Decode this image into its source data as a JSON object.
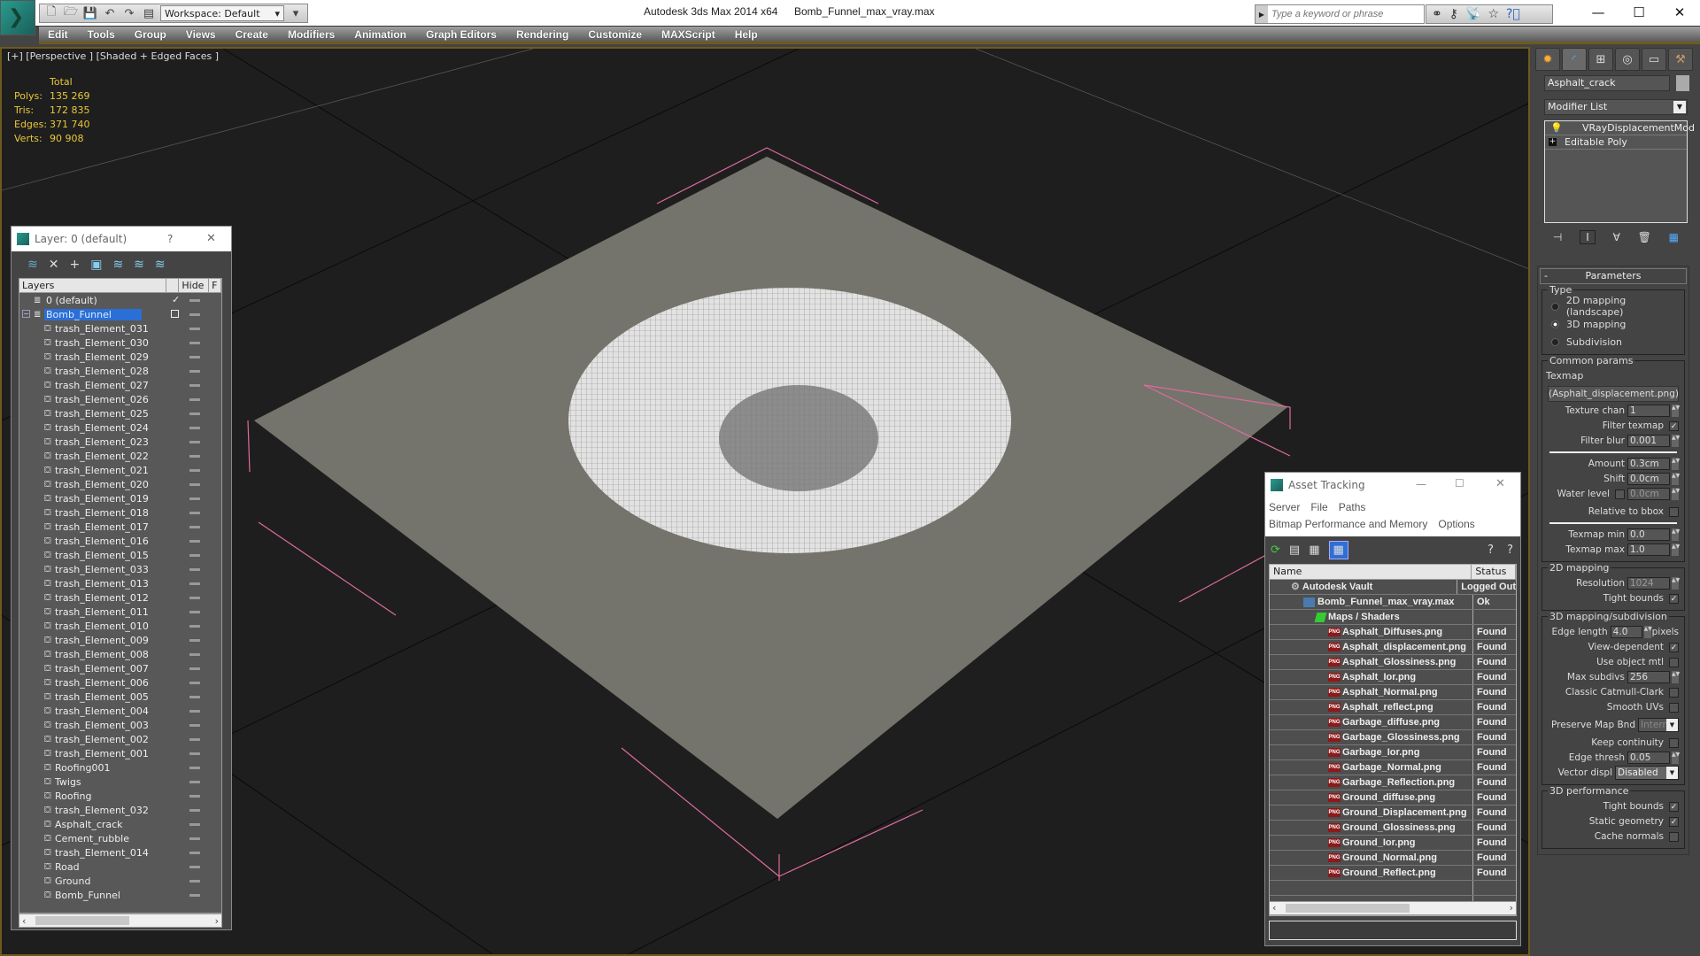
{
  "titlebar": {
    "app_title": "Autodesk 3ds Max  2014 x64",
    "file_name": "Bomb_Funnel_max_vray.max",
    "workspace": "Workspace: Default",
    "search_placeholder": "Type a keyword or phrase",
    "window_controls": {
      "minimize": "—",
      "maximize": "☐",
      "close": "✕"
    }
  },
  "menubar": {
    "items": [
      "Edit",
      "Tools",
      "Group",
      "Views",
      "Create",
      "Modifiers",
      "Animation",
      "Graph Editors",
      "Rendering",
      "Customize",
      "MAXScript",
      "Help"
    ]
  },
  "viewport": {
    "label": "[+] [Perspective ] [Shaded + Edged Faces ]",
    "stats": {
      "header": "Total",
      "rows": [
        {
          "label": "Polys:",
          "value": "135 269"
        },
        {
          "label": "Tris:",
          "value": "172 835"
        },
        {
          "label": "Edges:",
          "value": "371 740"
        },
        {
          "label": "Verts:",
          "value": "90 908"
        }
      ]
    }
  },
  "layer_window": {
    "title": "Layer: 0 (default)",
    "help": "?",
    "close": "✕",
    "columns": [
      "Layers",
      "",
      "Hide",
      "F"
    ],
    "layers": [
      {
        "name": "0 (default)",
        "type": "layer",
        "indent": 1,
        "current": true
      },
      {
        "name": "Bomb_Funnel",
        "type": "layer",
        "indent": 0,
        "selected": true,
        "expanded": true
      },
      {
        "name": "trash_Element_031",
        "type": "object"
      },
      {
        "name": "trash_Element_030",
        "type": "object"
      },
      {
        "name": "trash_Element_029",
        "type": "object"
      },
      {
        "name": "trash_Element_028",
        "type": "object"
      },
      {
        "name": "trash_Element_027",
        "type": "object"
      },
      {
        "name": "trash_Element_026",
        "type": "object"
      },
      {
        "name": "trash_Element_025",
        "type": "object"
      },
      {
        "name": "trash_Element_024",
        "type": "object"
      },
      {
        "name": "trash_Element_023",
        "type": "object"
      },
      {
        "name": "trash_Element_022",
        "type": "object"
      },
      {
        "name": "trash_Element_021",
        "type": "object"
      },
      {
        "name": "trash_Element_020",
        "type": "object"
      },
      {
        "name": "trash_Element_019",
        "type": "object"
      },
      {
        "name": "trash_Element_018",
        "type": "object"
      },
      {
        "name": "trash_Element_017",
        "type": "object"
      },
      {
        "name": "trash_Element_016",
        "type": "object"
      },
      {
        "name": "trash_Element_015",
        "type": "object"
      },
      {
        "name": "trash_Element_033",
        "type": "object"
      },
      {
        "name": "trash_Element_013",
        "type": "object"
      },
      {
        "name": "trash_Element_012",
        "type": "object"
      },
      {
        "name": "trash_Element_011",
        "type": "object"
      },
      {
        "name": "trash_Element_010",
        "type": "object"
      },
      {
        "name": "trash_Element_009",
        "type": "object"
      },
      {
        "name": "trash_Element_008",
        "type": "object"
      },
      {
        "name": "trash_Element_007",
        "type": "object"
      },
      {
        "name": "trash_Element_006",
        "type": "object"
      },
      {
        "name": "trash_Element_005",
        "type": "object"
      },
      {
        "name": "trash_Element_004",
        "type": "object"
      },
      {
        "name": "trash_Element_003",
        "type": "object"
      },
      {
        "name": "trash_Element_002",
        "type": "object"
      },
      {
        "name": "trash_Element_001",
        "type": "object"
      },
      {
        "name": "Roofing001",
        "type": "object"
      },
      {
        "name": "Twigs",
        "type": "object"
      },
      {
        "name": "Roofing",
        "type": "object"
      },
      {
        "name": "trash_Element_032",
        "type": "object"
      },
      {
        "name": "Asphalt_crack",
        "type": "object"
      },
      {
        "name": "Cement_rubble",
        "type": "object"
      },
      {
        "name": "trash_Element_014",
        "type": "object"
      },
      {
        "name": "Road",
        "type": "object"
      },
      {
        "name": "Ground",
        "type": "object"
      },
      {
        "name": "Bomb_Funnel",
        "type": "object"
      }
    ]
  },
  "asset_tracking": {
    "title": "Asset Tracking",
    "menus_row1": [
      "Server",
      "File",
      "Paths"
    ],
    "menus_row2": [
      "Bitmap Performance and Memory",
      "Options"
    ],
    "columns": [
      "Name",
      "Status"
    ],
    "rows": [
      {
        "name": "Autodesk Vault",
        "status": "Logged Out",
        "level": 0,
        "icon": "vault"
      },
      {
        "name": "Bomb_Funnel_max_vray.max",
        "status": "Ok",
        "level": 1,
        "icon": "max"
      },
      {
        "name": "Maps / Shaders",
        "status": "",
        "level": 2,
        "icon": "maps"
      },
      {
        "name": "Asphalt_Diffuses.png",
        "status": "Found",
        "level": 3,
        "icon": "png"
      },
      {
        "name": "Asphalt_displacement.png",
        "status": "Found",
        "level": 3,
        "icon": "png"
      },
      {
        "name": "Asphalt_Glossiness.png",
        "status": "Found",
        "level": 3,
        "icon": "png"
      },
      {
        "name": "Asphalt_Ior.png",
        "status": "Found",
        "level": 3,
        "icon": "png"
      },
      {
        "name": "Asphalt_Normal.png",
        "status": "Found",
        "level": 3,
        "icon": "png"
      },
      {
        "name": "Asphalt_reflect.png",
        "status": "Found",
        "level": 3,
        "icon": "png"
      },
      {
        "name": "Garbage_diffuse.png",
        "status": "Found",
        "level": 3,
        "icon": "png"
      },
      {
        "name": "Garbage_Glossiness.png",
        "status": "Found",
        "level": 3,
        "icon": "png"
      },
      {
        "name": "Garbage_Ior.png",
        "status": "Found",
        "level": 3,
        "icon": "png"
      },
      {
        "name": "Garbage_Normal.png",
        "status": "Found",
        "level": 3,
        "icon": "png"
      },
      {
        "name": "Garbage_Reflection.png",
        "status": "Found",
        "level": 3,
        "icon": "png"
      },
      {
        "name": "Ground_diffuse.png",
        "status": "Found",
        "level": 3,
        "icon": "png"
      },
      {
        "name": "Ground_Displacement.png",
        "status": "Found",
        "level": 3,
        "icon": "png"
      },
      {
        "name": "Ground_Glossiness.png",
        "status": "Found",
        "level": 3,
        "icon": "png"
      },
      {
        "name": "Ground_Ior.png",
        "status": "Found",
        "level": 3,
        "icon": "png"
      },
      {
        "name": "Ground_Normal.png",
        "status": "Found",
        "level": 3,
        "icon": "png"
      },
      {
        "name": "Ground_Reflect.png",
        "status": "Found",
        "level": 3,
        "icon": "png"
      }
    ]
  },
  "command_panel": {
    "object_name": "Asphalt_crack",
    "modifier_list": "Modifier List",
    "stack": [
      "VRayDisplacementMod",
      "Editable Poly"
    ],
    "parameters": {
      "rollout": "Parameters",
      "type_group": "Type",
      "type_options": [
        {
          "label": "2D mapping (landscape)",
          "selected": false
        },
        {
          "label": "3D mapping",
          "selected": true
        },
        {
          "label": "Subdivision",
          "selected": false
        }
      ],
      "common_group": "Common params",
      "texmap_label": "Texmap",
      "texmap_value": "(Asphalt_displacement.png)",
      "texture_chan": {
        "label": "Texture chan",
        "value": "1"
      },
      "filter_texmap": {
        "label": "Filter texmap",
        "checked": true
      },
      "filter_blur": {
        "label": "Filter blur",
        "value": "0.001"
      },
      "amount": {
        "label": "Amount",
        "value": "0.3cm"
      },
      "shift": {
        "label": "Shift",
        "value": "0.0cm"
      },
      "water_level": {
        "label": "Water level",
        "value": "0.0cm",
        "checked": false
      },
      "relative_bbox": {
        "label": "Relative to bbox",
        "checked": false
      },
      "texmap_min": {
        "label": "Texmap min",
        "value": "0.0"
      },
      "texmap_max": {
        "label": "Texmap max",
        "value": "1.0"
      },
      "mapping2d_group": "2D mapping",
      "resolution": {
        "label": "Resolution",
        "value": "1024"
      },
      "tight_bounds_2d": {
        "label": "Tight bounds",
        "checked": true
      },
      "mapping3d_group": "3D mapping/subdivision",
      "edge_length": {
        "label": "Edge length",
        "value": "4.0",
        "unit": "pixels"
      },
      "view_dependent": {
        "label": "View-dependent",
        "checked": true
      },
      "use_object_mtl": {
        "label": "Use object mtl",
        "checked": false
      },
      "max_subdivs": {
        "label": "Max subdivs",
        "value": "256"
      },
      "classic_catmull": {
        "label": "Classic Catmull-Clark",
        "checked": false
      },
      "smooth_uvs": {
        "label": "Smooth UVs",
        "checked": false
      },
      "preserve_map_bnd": {
        "label": "Preserve Map Bnd",
        "value": "Interr"
      },
      "keep_continuity": {
        "label": "Keep continuity",
        "checked": false
      },
      "edge_thresh": {
        "label": "Edge thresh",
        "value": "0.05"
      },
      "vector_displ": {
        "label": "Vector displ",
        "value": "Disabled"
      },
      "perf_group": "3D performance",
      "tight_bounds_3d": {
        "label": "Tight bounds",
        "checked": true
      },
      "static_geometry": {
        "label": "Static geometry",
        "checked": true
      },
      "cache_normals": {
        "label": "Cache normals",
        "checked": false
      }
    }
  }
}
